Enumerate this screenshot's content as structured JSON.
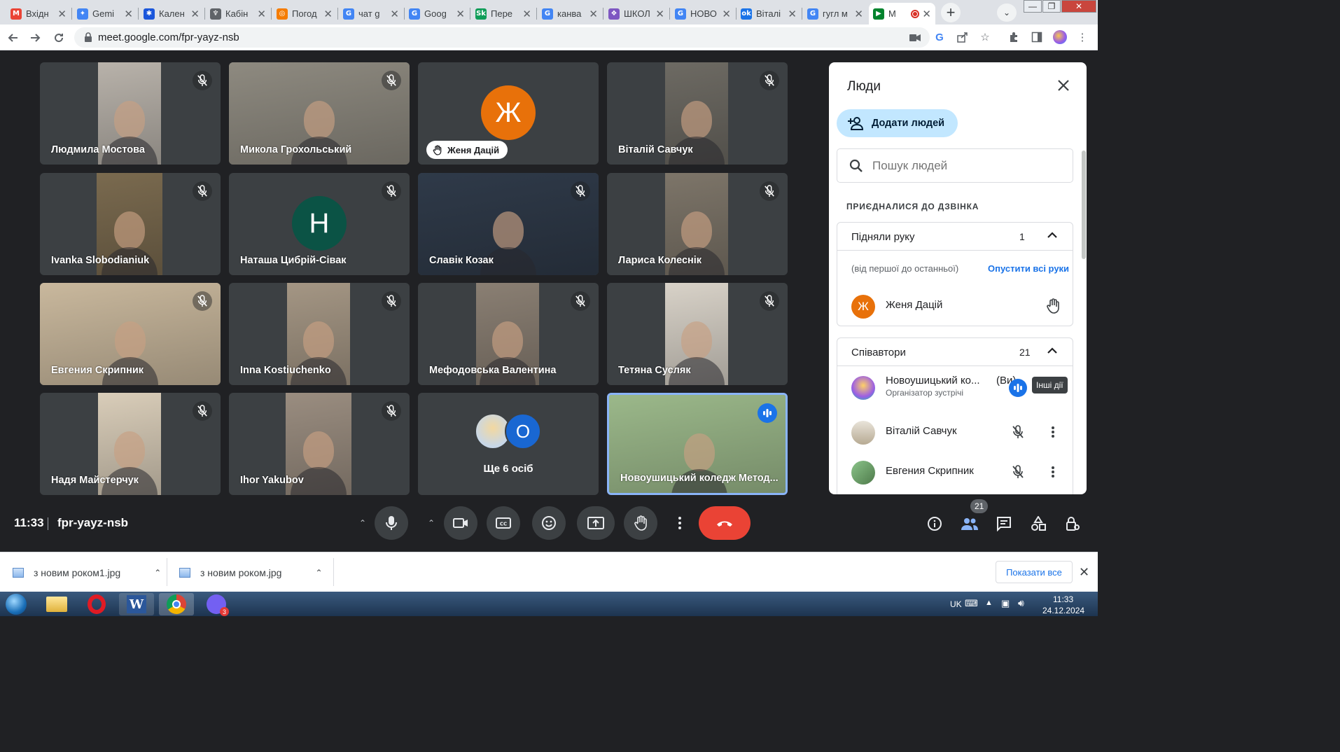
{
  "browser": {
    "tabs": [
      {
        "title": "Вхідн",
        "fav": "gmail-icon",
        "color": "#ea4335",
        "glyph": "M"
      },
      {
        "title": "Gemi",
        "fav": "gemini-icon",
        "color": "#4285f4",
        "glyph": "✦"
      },
      {
        "title": "Кален",
        "fav": "calendar-icon",
        "color": "#1a56db",
        "glyph": "✱"
      },
      {
        "title": "Кабін",
        "fav": "ukrainian-emblem-icon",
        "color": "#5f6368",
        "glyph": "♆"
      },
      {
        "title": "Погод",
        "fav": "weather-icon",
        "color": "#f57c00",
        "glyph": "◎"
      },
      {
        "title": "чат g",
        "fav": "google-icon",
        "color": "#4285f4",
        "glyph": "G"
      },
      {
        "title": "Goog",
        "fav": "google-docs-icon",
        "color": "#4285f4",
        "glyph": "G"
      },
      {
        "title": "Пере",
        "fav": "sk-icon",
        "color": "#0f9d58",
        "glyph": "Sk"
      },
      {
        "title": "канва",
        "fav": "google-icon",
        "color": "#4285f4",
        "glyph": "G"
      },
      {
        "title": "ШКОЛ",
        "fav": "school-icon",
        "color": "#7e57c2",
        "glyph": "❖"
      },
      {
        "title": "НОВО",
        "fav": "google-icon",
        "color": "#4285f4",
        "glyph": "G"
      },
      {
        "title": "Віталі",
        "fav": "ok-icon",
        "color": "#1a73e8",
        "glyph": "ok"
      },
      {
        "title": "гугл м",
        "fav": "google-icon",
        "color": "#4285f4",
        "glyph": "G"
      },
      {
        "title": "М",
        "fav": "google-meet-icon",
        "color": "#00832d",
        "glyph": "▶"
      }
    ],
    "url": "meet.google.com/fpr-yayz-nsb"
  },
  "meet": {
    "tiles": [
      {
        "name": "Людмила Мостова",
        "video": true,
        "bg": "#b8b2aa",
        "pad": "#3c4043",
        "vleft": 83,
        "vwidth": 90,
        "muted": true
      },
      {
        "name": "Микола Грохольський",
        "video": true,
        "bg": "#8e8a80",
        "pad": "#3c4043",
        "vleft": 0,
        "vwidth": 258,
        "muted": true
      },
      {
        "name": "Женя Дацій",
        "video": false,
        "avatar_letter": "Ж",
        "avatar_color": "#e8710a",
        "hand_raised": true,
        "muted": false
      },
      {
        "name": "Віталій Савчук",
        "video": true,
        "bg": "#6d6a63",
        "pad": "#3c4043",
        "vleft": 83,
        "vwidth": 90,
        "muted": true
      },
      {
        "name": "Ivanka Slobodianiuk",
        "video": true,
        "bg": "#7a6a4f",
        "pad": "#3c4043",
        "vleft": 81,
        "vwidth": 94,
        "muted": true
      },
      {
        "name": "Наташа Цибрій-Сівак",
        "video": false,
        "avatar_letter": "Н",
        "avatar_color": "#0b5345",
        "muted": true
      },
      {
        "name": "Славік Козак",
        "video": true,
        "bg": "#2f3a49",
        "pad": "#3c4043",
        "vleft": 0,
        "vwidth": 258,
        "muted": true
      },
      {
        "name": "Лариса Колеснік",
        "video": true,
        "bg": "#7d7569",
        "pad": "#3c4043",
        "vleft": 83,
        "vwidth": 90,
        "muted": true
      },
      {
        "name": "Евгения Скрипник",
        "video": true,
        "bg": "#c9b89d",
        "pad": "#3c4043",
        "vleft": 0,
        "vwidth": 258,
        "muted": true
      },
      {
        "name": "Inna Kostiuchenko",
        "video": true,
        "bg": "#a49684",
        "pad": "#3c4043",
        "vleft": 83,
        "vwidth": 90,
        "muted": true
      },
      {
        "name": "Мефодовська Валентина",
        "video": true,
        "bg": "#8a7f73",
        "pad": "#3c4043",
        "vleft": 83,
        "vwidth": 90,
        "muted": true
      },
      {
        "name": "Тетяна Сусляк",
        "video": true,
        "bg": "#d8d2c8",
        "pad": "#3c4043",
        "vleft": 83,
        "vwidth": 90,
        "muted": true
      },
      {
        "name": "Надя Майстерчук",
        "video": true,
        "bg": "#d9cdb9",
        "pad": "#3c4043",
        "vleft": 83,
        "vwidth": 90,
        "muted": true
      },
      {
        "name": "Ihor Yakubov",
        "video": true,
        "bg": "#9a8d80",
        "pad": "#3c4043",
        "vleft": 81,
        "vwidth": 94,
        "muted": true
      },
      {
        "name": "",
        "others": true,
        "others_label": "Ще 6 осіб",
        "other_letter": "О"
      },
      {
        "name": "Новоушицький коледж Метод...",
        "video": true,
        "bg": "#9bb88a",
        "pad": "#3c4043",
        "vleft": 0,
        "vwidth": 258,
        "speaking": true,
        "muted": false
      }
    ],
    "time": "11:33",
    "code": "fpr-yayz-nsb",
    "participant_badge": "21",
    "controls": {
      "mic": "microphone-icon",
      "camera": "camera-icon",
      "captions": "captions-icon",
      "reactions": "emoji-icon",
      "present": "present-screen-icon",
      "raise_hand": "hand-icon",
      "more": "more-options-icon",
      "leave": "end-call-icon"
    }
  },
  "people_panel": {
    "title": "Люди",
    "add_people": "Додати людей",
    "search_placeholder": "Пошук людей",
    "joined_label": "ПРИЄДНАЛИСЯ ДО ДЗВІНКА",
    "raised_hands": {
      "label": "Підняли руку",
      "count": "1",
      "order_note": "(від першої до останньої)",
      "lower_all": "Опустити всі руки",
      "person": {
        "name": "Женя Дацій",
        "letter": "Ж",
        "color": "#e8710a"
      }
    },
    "contributors": {
      "label": "Співавтори",
      "count": "21",
      "people": [
        {
          "name": "Новоушицький ко...",
          "you": "(Ви)",
          "role": "Організатор зустрічі"
        },
        {
          "name": "Віталій Савчук"
        },
        {
          "name": "Евгения Скрипник"
        }
      ]
    },
    "tooltip": "Інші дії"
  },
  "downloads": {
    "items": [
      "з новим роком1.jpg",
      "з новим роком.jpg"
    ],
    "show_all": "Показати все"
  },
  "taskbar": {
    "lang": "UK",
    "time": "11:33",
    "date": "24.12.2024"
  },
  "colors": {
    "meet_bg": "#202124",
    "tile_bg": "#3c4043",
    "accent": "#1a73e8",
    "hangup": "#ea4335",
    "chip": "#c2e7ff"
  }
}
